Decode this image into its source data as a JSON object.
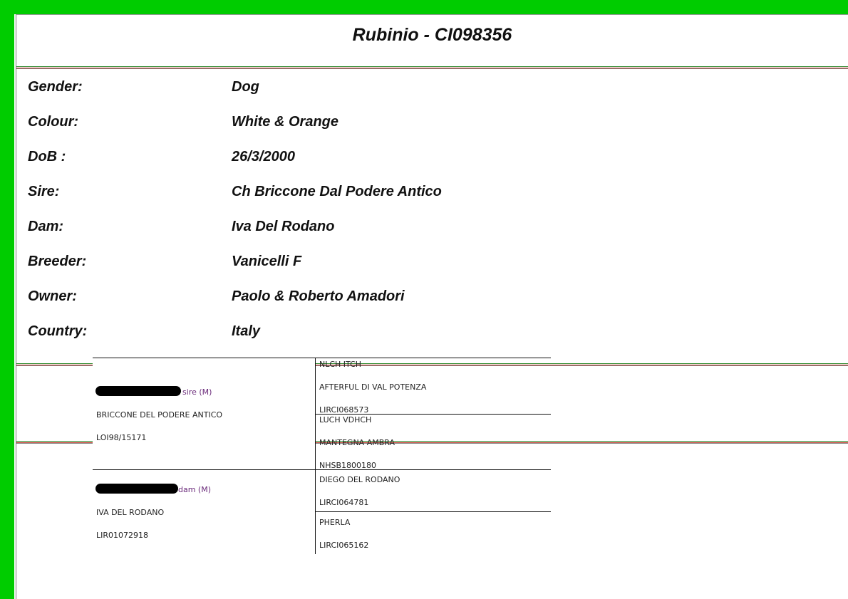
{
  "title": "Rubinio - CI098356",
  "details": [
    {
      "label": "Gender:",
      "value": "Dog"
    },
    {
      "label": "Colour:",
      "value": "White & Orange"
    },
    {
      "label": "DoB :",
      "value": "26/3/2000"
    },
    {
      "label": "Sire:",
      "value": "Ch Briccone Dal Podere Antico"
    },
    {
      "label": "Dam:",
      "value": "Iva Del Rodano"
    },
    {
      "label": "Breeder:",
      "value": "Vanicelli F"
    },
    {
      "label": "Owner:",
      "value": "Paolo & Roberto Amadori"
    },
    {
      "label": "Country:",
      "value": "Italy"
    }
  ],
  "pedigree": {
    "sire": {
      "role_suffix": "sire (M)",
      "name": "BRICCONE DEL PODERE ANTICO",
      "reg": "LOI98/15171",
      "sire": {
        "titles": "NLCH ITCH",
        "name": "AFTERFUL DI VAL POTENZA",
        "reg": "LIRCI068573"
      },
      "dam": {
        "titles": "LUCH VDHCH",
        "name": "MANTEGNA AMBRA",
        "reg": "NHSB1800180"
      }
    },
    "dam": {
      "role_suffix": "dam (M)",
      "name": "IVA DEL RODANO",
      "reg": "LIR01072918",
      "sire": {
        "name": "DIEGO DEL RODANO",
        "reg": "LIRCI064781"
      },
      "dam": {
        "name": "PHERLA",
        "reg": "LIRCI065162"
      }
    }
  },
  "colors": {
    "frame_green": "#00cc00",
    "rule_green": "#2e8b2e",
    "rule_red": "#c0392b"
  }
}
